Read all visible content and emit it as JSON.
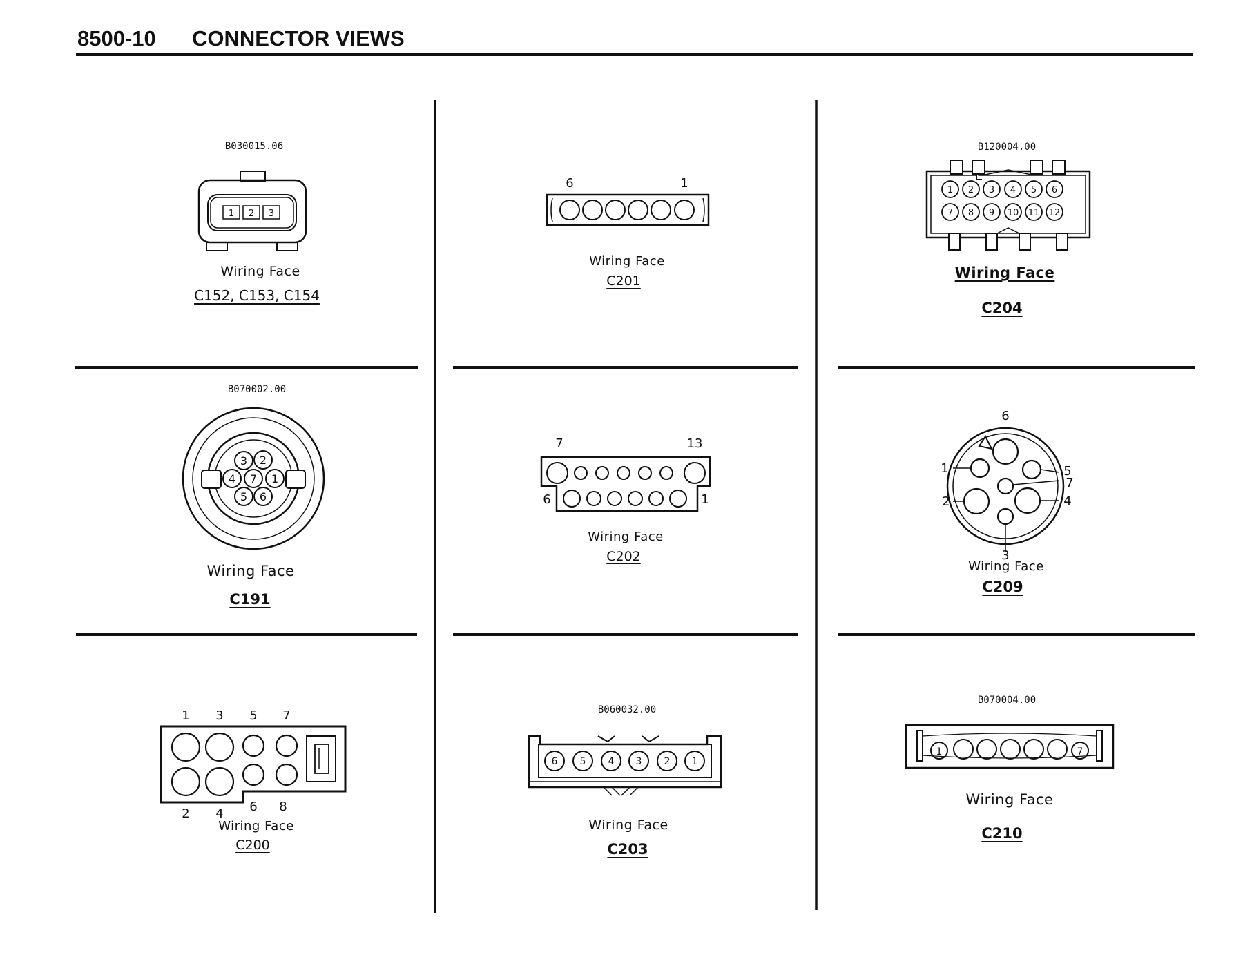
{
  "header": {
    "section": "8500-10",
    "title": "CONNECTOR VIEWS"
  },
  "connectors": [
    {
      "id": "c152",
      "part_number": "B030015.06",
      "face_label": "Wiring Face",
      "code": "C152, C153, C154",
      "pins": [
        "1",
        "2",
        "3"
      ]
    },
    {
      "id": "c201",
      "part_number": "",
      "face_label": "Wiring Face",
      "code": "C201",
      "pins": [
        "6",
        "1"
      ]
    },
    {
      "id": "c204",
      "part_number": "B120004.00",
      "face_label": "Wiring Face",
      "code": "C204",
      "pins": [
        "1",
        "2",
        "3",
        "4",
        "5",
        "6",
        "7",
        "8",
        "9",
        "10",
        "11",
        "12"
      ]
    },
    {
      "id": "c191",
      "part_number": "B070002.00",
      "face_label": "Wiring Face",
      "code": "C191",
      "pins": [
        "3",
        "2",
        "4",
        "7",
        "1",
        "5",
        "6"
      ]
    },
    {
      "id": "c202",
      "part_number": "",
      "face_label": "Wiring Face",
      "code": "C202",
      "pins": [
        "7",
        "13",
        "6",
        "1"
      ]
    },
    {
      "id": "c209",
      "part_number": "",
      "face_label": "Wiring Face",
      "code": "C209",
      "pins": [
        "6",
        "1",
        "5",
        "7",
        "2",
        "4",
        "3"
      ]
    },
    {
      "id": "c200",
      "part_number": "",
      "face_label": "Wiring Face",
      "code": "C200",
      "pins": [
        "1",
        "3",
        "5",
        "7",
        "2",
        "4",
        "6",
        "8"
      ]
    },
    {
      "id": "c203",
      "part_number": "B060032.00",
      "face_label": "Wiring Face",
      "code": "C203",
      "pins": [
        "6",
        "5",
        "4",
        "3",
        "2",
        "1"
      ]
    },
    {
      "id": "c210",
      "part_number": "B070004.00",
      "face_label": "Wiring Face",
      "code": "C210",
      "pins": [
        "1",
        "7"
      ]
    }
  ]
}
